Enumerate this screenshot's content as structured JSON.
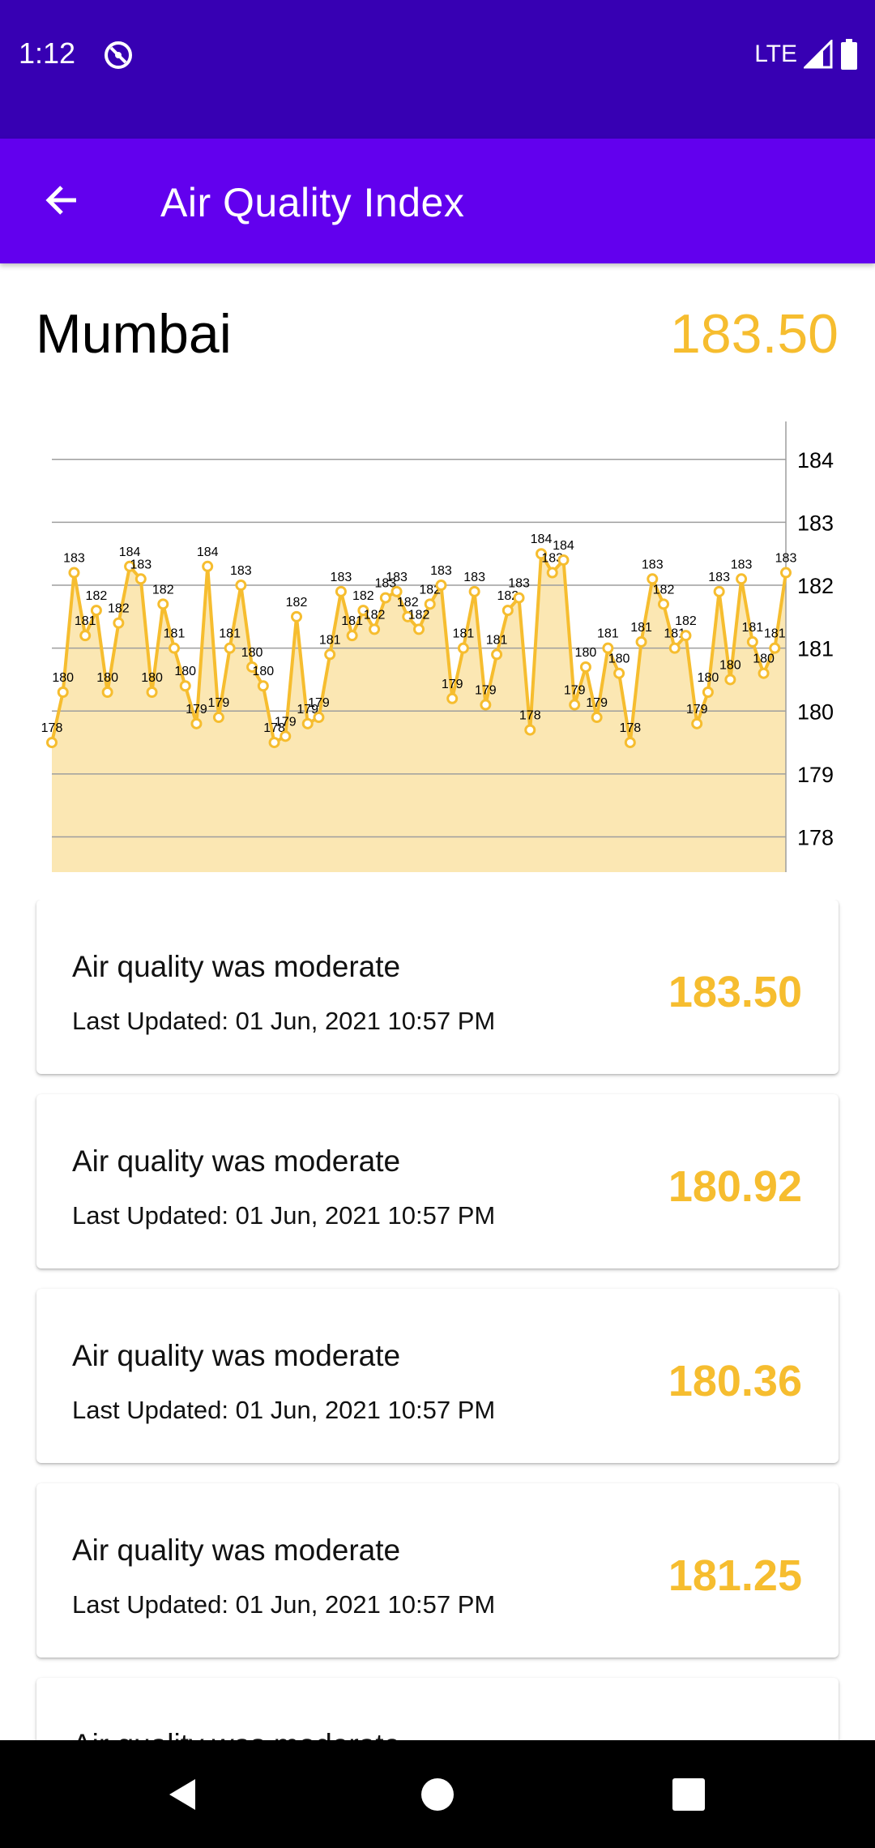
{
  "status_bar": {
    "time": "1:12",
    "network": "LTE",
    "icons": [
      "alert-circle-icon",
      "signal-icon",
      "battery-icon"
    ]
  },
  "app_bar": {
    "title": "Air Quality Index",
    "back_icon": "arrow-left-icon"
  },
  "header": {
    "city": "Mumbai",
    "current_value": "183.50"
  },
  "colors": {
    "status_bar": "#3700b3",
    "app_bar": "#6200ee",
    "accent": "#f6bd2f",
    "chart_fill": "#fbe7b3"
  },
  "chart_data": {
    "type": "line",
    "grid": true,
    "y_axis_position": "right",
    "ylim": [
      177.44,
      184.5
    ],
    "y_ticks": [
      178,
      179,
      180,
      181,
      182,
      183,
      184
    ],
    "point_labels": true,
    "values": [
      179.5,
      180.3,
      182.2,
      181.2,
      181.6,
      180.3,
      181.4,
      182.3,
      182.1,
      180.3,
      181.7,
      181.0,
      180.4,
      179.8,
      182.3,
      179.9,
      181.0,
      182.0,
      180.7,
      180.4,
      179.5,
      179.6,
      181.5,
      179.8,
      179.9,
      180.9,
      181.9,
      181.2,
      181.6,
      181.3,
      181.8,
      181.9,
      181.5,
      181.3,
      181.7,
      182.0,
      180.2,
      181.0,
      181.9,
      180.1,
      180.9,
      181.6,
      181.8,
      179.7,
      182.5,
      182.2,
      182.4,
      180.1,
      180.7,
      179.9,
      181.0,
      180.6,
      179.5,
      181.1,
      182.1,
      181.7,
      181.0,
      181.2,
      179.8,
      180.3,
      181.9,
      180.5,
      182.1,
      181.1,
      180.6,
      181.0,
      182.2
    ],
    "labels": [
      "178",
      "180",
      "183",
      "181",
      "182",
      "180",
      "182",
      "184",
      "183",
      "180",
      "182",
      "181",
      "180",
      "179",
      "184",
      "179",
      "181",
      "183",
      "180",
      "180",
      "178",
      "179",
      "182",
      "179",
      "179",
      "181",
      "183",
      "181",
      "182",
      "182",
      "183",
      "183",
      "182",
      "182",
      "182",
      "183",
      "179",
      "181",
      "183",
      "179",
      "181",
      "182",
      "183",
      "178",
      "184",
      "183",
      "184",
      "179",
      "180",
      "179",
      "181",
      "180",
      "178",
      "181",
      "183",
      "182",
      "181",
      "182",
      "179",
      "180",
      "183",
      "180",
      "183",
      "181",
      "180",
      "181",
      "183"
    ]
  },
  "readings": [
    {
      "title": "Air quality was moderate",
      "updated": "Last Updated: 01 Jun, 2021 10:57 PM",
      "value": "183.50"
    },
    {
      "title": "Air quality was moderate",
      "updated": "Last Updated: 01 Jun, 2021 10:57 PM",
      "value": "180.92"
    },
    {
      "title": "Air quality was moderate",
      "updated": "Last Updated: 01 Jun, 2021 10:57 PM",
      "value": "180.36"
    },
    {
      "title": "Air quality was moderate",
      "updated": "Last Updated: 01 Jun, 2021 10:57 PM",
      "value": "181.25"
    },
    {
      "title": "Air quality was moderate",
      "updated": "",
      "value": ""
    }
  ],
  "nav_bar": {
    "icons": [
      "back-triangle-icon",
      "home-circle-icon",
      "recents-square-icon"
    ]
  }
}
